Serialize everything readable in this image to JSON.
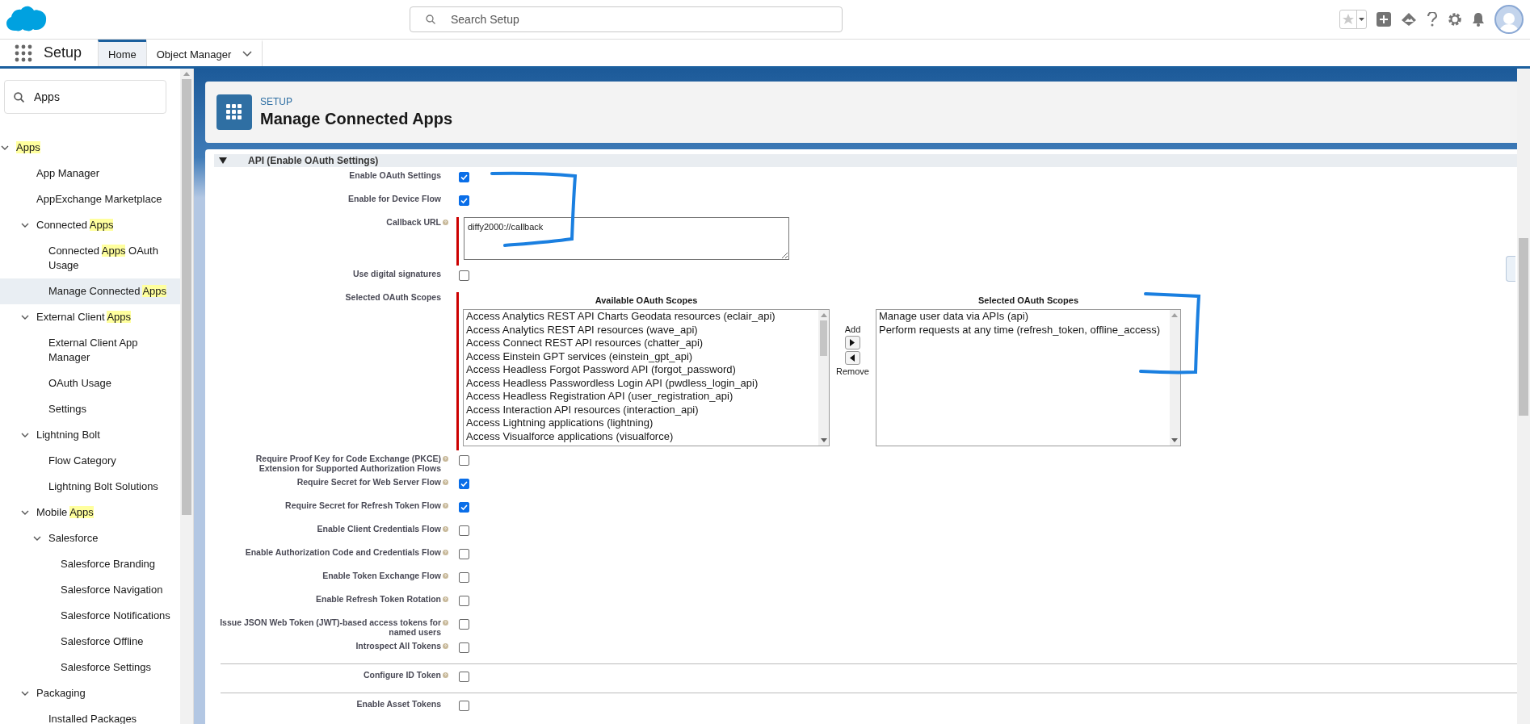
{
  "top_bar": {
    "search": {
      "placeholder": "Search Setup"
    }
  },
  "nav": {
    "app_name": "Setup",
    "tabs": [
      {
        "label": "Home",
        "selected": true,
        "has_menu": false
      },
      {
        "label": "Object Manager",
        "selected": false,
        "has_menu": true
      }
    ]
  },
  "sidebar": {
    "search": {
      "value": "Apps"
    },
    "items": [
      {
        "label": [
          {
            "text": "Apps",
            "highlight": true
          }
        ],
        "selected": false,
        "expanded": true,
        "children": [
          {
            "label": [
              {
                "text": "App Manager",
                "highlight": false
              }
            ],
            "selected": false
          },
          {
            "label": [
              {
                "text": "AppExchange Marketplace",
                "highlight": false
              }
            ],
            "selected": false
          },
          {
            "label": [
              {
                "text": "Connected ",
                "highlight": false
              },
              {
                "text": "Apps",
                "highlight": true
              }
            ],
            "selected": false,
            "expanded": true,
            "children": [
              {
                "label": [
                  {
                    "text": "Connected ",
                    "highlight": false
                  },
                  {
                    "text": "Apps",
                    "highlight": true
                  },
                  {
                    "text": " OAuth Usage",
                    "highlight": false
                  }
                ],
                "selected": false
              },
              {
                "label": [
                  {
                    "text": "Manage Connected ",
                    "highlight": false
                  },
                  {
                    "text": "Apps",
                    "highlight": true
                  }
                ],
                "selected": true
              }
            ]
          },
          {
            "label": [
              {
                "text": "External Client ",
                "highlight": false
              },
              {
                "text": "Apps",
                "highlight": true
              }
            ],
            "selected": false,
            "expanded": true,
            "children": [
              {
                "label": [
                  {
                    "text": "External Client App Manager",
                    "highlight": false
                  }
                ],
                "selected": false
              },
              {
                "label": [
                  {
                    "text": "OAuth Usage",
                    "highlight": false
                  }
                ],
                "selected": false
              },
              {
                "label": [
                  {
                    "text": "Settings",
                    "highlight": false
                  }
                ],
                "selected": false
              }
            ]
          },
          {
            "label": [
              {
                "text": "Lightning Bolt",
                "highlight": false
              }
            ],
            "selected": false,
            "expanded": true,
            "children": [
              {
                "label": [
                  {
                    "text": "Flow Category",
                    "highlight": false
                  }
                ],
                "selected": false
              },
              {
                "label": [
                  {
                    "text": "Lightning Bolt Solutions",
                    "highlight": false
                  }
                ],
                "selected": false
              }
            ]
          },
          {
            "label": [
              {
                "text": "Mobile ",
                "highlight": false
              },
              {
                "text": "Apps",
                "highlight": true
              }
            ],
            "selected": false,
            "expanded": true,
            "children": [
              {
                "label": [
                  {
                    "text": "Salesforce",
                    "highlight": false
                  }
                ],
                "selected": false,
                "expanded": true,
                "children": [
                  {
                    "label": [
                      {
                        "text": "Salesforce Branding",
                        "highlight": false
                      }
                    ],
                    "selected": false
                  },
                  {
                    "label": [
                      {
                        "text": "Salesforce Navigation",
                        "highlight": false
                      }
                    ],
                    "selected": false
                  },
                  {
                    "label": [
                      {
                        "text": "Salesforce Notifications",
                        "highlight": false
                      }
                    ],
                    "selected": false
                  },
                  {
                    "label": [
                      {
                        "text": "Salesforce Offline",
                        "highlight": false
                      }
                    ],
                    "selected": false
                  },
                  {
                    "label": [
                      {
                        "text": "Salesforce Settings",
                        "highlight": false
                      }
                    ],
                    "selected": false
                  }
                ]
              }
            ]
          },
          {
            "label": [
              {
                "text": "Packaging",
                "highlight": false
              }
            ],
            "selected": false,
            "expanded": true,
            "children": [
              {
                "label": [
                  {
                    "text": "Installed Packages",
                    "highlight": false
                  }
                ],
                "selected": false
              }
            ]
          }
        ]
      }
    ]
  },
  "page_header": {
    "eyebrow": "SETUP",
    "title": "Manage Connected Apps"
  },
  "section": {
    "title": "API (Enable OAuth Settings)",
    "expanded": true,
    "rows": [
      {
        "kind": "checkbox",
        "label": "Enable OAuth Settings",
        "help": false,
        "checked": true
      },
      {
        "kind": "checkbox",
        "label": "Enable for Device Flow",
        "help": false,
        "checked": true
      },
      {
        "kind": "textarea",
        "label": "Callback URL",
        "help": true,
        "required": true,
        "value": "diffy2000://callback"
      },
      {
        "kind": "checkbox",
        "label": "Use digital signatures",
        "help": false,
        "checked": false
      },
      {
        "kind": "scopes",
        "label": "Selected OAuth Scopes",
        "help": false,
        "required": true,
        "available_title": "Available OAuth Scopes",
        "selected_title": "Selected OAuth Scopes",
        "add_label": "Add",
        "remove_label": "Remove",
        "available": [
          "Access Analytics REST API Charts Geodata resources (eclair_api)",
          "Access Analytics REST API resources (wave_api)",
          "Access Connect REST API resources (chatter_api)",
          "Access Einstein GPT services (einstein_gpt_api)",
          "Access Headless Forgot Password API (forgot_password)",
          "Access Headless Passwordless Login API (pwdless_login_api)",
          "Access Headless Registration API (user_registration_api)",
          "Access Interaction API resources (interaction_api)",
          "Access Lightning applications (lightning)",
          "Access Visualforce applications (visualforce)"
        ],
        "selected": [
          "Manage user data via APIs (api)",
          "Perform requests at any time (refresh_token, offline_access)"
        ]
      },
      {
        "kind": "checkbox",
        "label": "Require Proof Key for Code Exchange (PKCE) Extension for Supported Authorization Flows",
        "help": true,
        "checked": false
      },
      {
        "kind": "checkbox",
        "label": "Require Secret for Web Server Flow",
        "help": true,
        "checked": true
      },
      {
        "kind": "checkbox",
        "label": "Require Secret for Refresh Token Flow",
        "help": true,
        "checked": true
      },
      {
        "kind": "checkbox",
        "label": "Enable Client Credentials Flow",
        "help": true,
        "checked": false
      },
      {
        "kind": "checkbox",
        "label": "Enable Authorization Code and Credentials Flow",
        "help": true,
        "checked": false
      },
      {
        "kind": "checkbox",
        "label": "Enable Token Exchange Flow",
        "help": true,
        "checked": false
      },
      {
        "kind": "checkbox",
        "label": "Enable Refresh Token Rotation",
        "help": true,
        "checked": false
      },
      {
        "kind": "checkbox",
        "label": "Issue JSON Web Token (JWT)-based access tokens for named users",
        "help": true,
        "checked": false
      },
      {
        "kind": "checkbox",
        "label": "Introspect All Tokens",
        "help": true,
        "checked": false
      },
      {
        "kind": "divider"
      },
      {
        "kind": "checkbox",
        "label": "Configure ID Token",
        "help": true,
        "checked": false
      },
      {
        "kind": "divider"
      },
      {
        "kind": "checkbox",
        "label": "Enable Asset Tokens",
        "help": false,
        "checked": false
      }
    ]
  }
}
